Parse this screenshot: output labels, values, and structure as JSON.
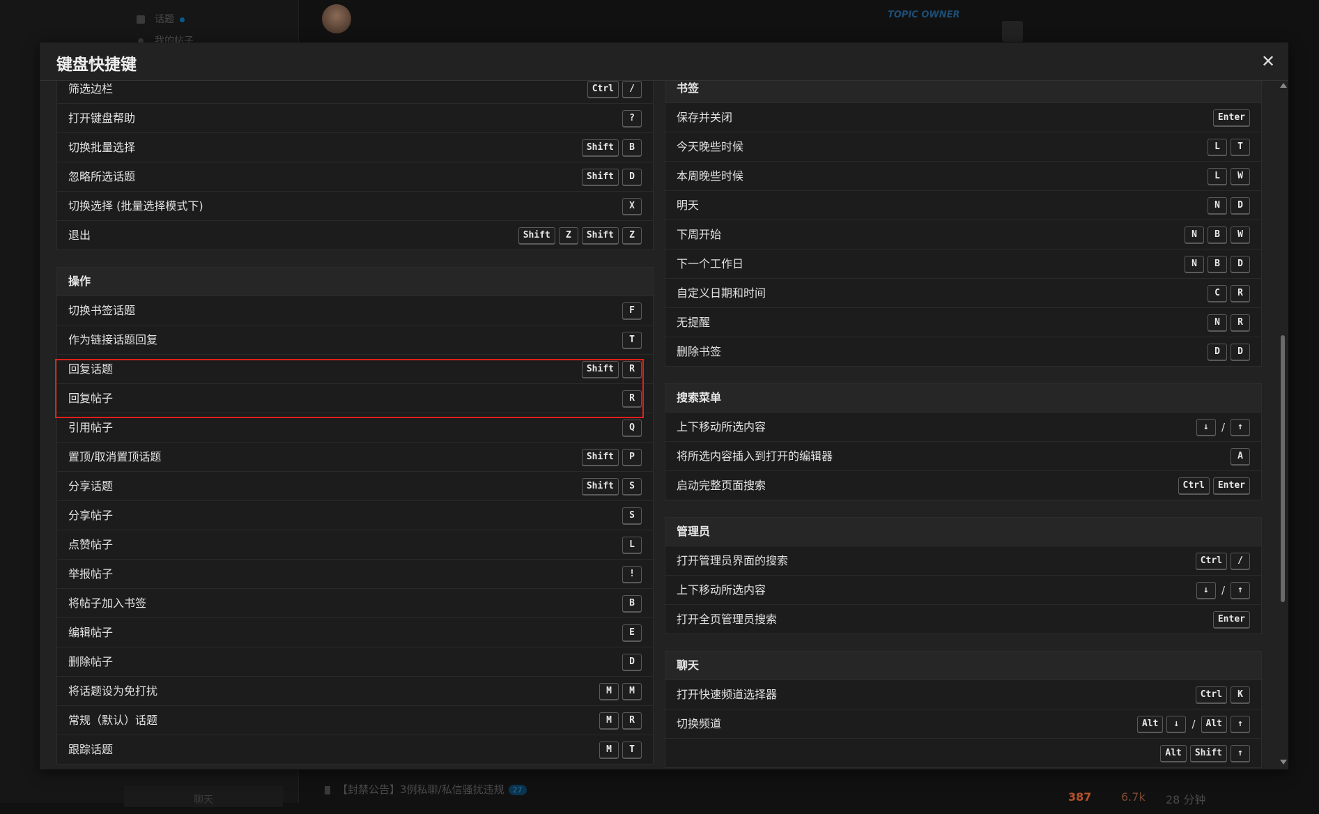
{
  "background": {
    "sidebar_items": [
      "话题",
      "我的帖子"
    ],
    "topic_owner": "TOPIC OWNER",
    "bottom_sidebar_item": "聊天",
    "announcement": "【封禁公告】3例私聊/私信骚扰违规",
    "announcement_badge": "27",
    "stats": [
      "387",
      "6.7k",
      "28 分钟"
    ]
  },
  "modal": {
    "title": "键盘快捷键",
    "close_symbol": "✕"
  },
  "left_top_rows": [
    {
      "label": "筛选边栏",
      "keys": [
        "Ctrl",
        "/"
      ]
    },
    {
      "label": "打开键盘帮助",
      "keys": [
        "?"
      ]
    },
    {
      "label": "切换批量选择",
      "keys": [
        "Shift",
        "B"
      ]
    },
    {
      "label": "忽略所选话题",
      "keys": [
        "Shift",
        "D"
      ]
    },
    {
      "label": "切换选择 (批量选择模式下)",
      "keys": [
        "X"
      ]
    },
    {
      "label": "退出",
      "keys": [
        "Shift",
        "Z",
        "Shift",
        "Z"
      ]
    }
  ],
  "actions": {
    "title": "操作",
    "rows": [
      {
        "label": "切换书签话题",
        "keys": [
          "F"
        ]
      },
      {
        "label": "作为链接话题回复",
        "keys": [
          "T"
        ]
      },
      {
        "label": "回复话题",
        "keys": [
          "Shift",
          "R"
        ]
      },
      {
        "label": "回复帖子",
        "keys": [
          "R"
        ]
      },
      {
        "label": "引用帖子",
        "keys": [
          "Q"
        ]
      },
      {
        "label": "置顶/取消置顶话题",
        "keys": [
          "Shift",
          "P"
        ]
      },
      {
        "label": "分享话题",
        "keys": [
          "Shift",
          "S"
        ]
      },
      {
        "label": "分享帖子",
        "keys": [
          "S"
        ]
      },
      {
        "label": "点赞帖子",
        "keys": [
          "L"
        ]
      },
      {
        "label": "举报帖子",
        "keys": [
          "!"
        ]
      },
      {
        "label": "将帖子加入书签",
        "keys": [
          "B"
        ]
      },
      {
        "label": "编辑帖子",
        "keys": [
          "E"
        ]
      },
      {
        "label": "删除帖子",
        "keys": [
          "D"
        ]
      },
      {
        "label": "将话题设为免打扰",
        "keys": [
          "M",
          "M"
        ]
      },
      {
        "label": "常规（默认）话题",
        "keys": [
          "M",
          "R"
        ]
      },
      {
        "label": "跟踪话题",
        "keys": [
          "M",
          "T"
        ]
      }
    ]
  },
  "bookmarks": {
    "title": "书签",
    "rows": [
      {
        "label": "保存并关闭",
        "keys": [
          "Enter"
        ]
      },
      {
        "label": "今天晚些时候",
        "keys": [
          "L",
          "T"
        ]
      },
      {
        "label": "本周晚些时候",
        "keys": [
          "L",
          "W"
        ]
      },
      {
        "label": "明天",
        "keys": [
          "N",
          "D"
        ]
      },
      {
        "label": "下周开始",
        "keys": [
          "N",
          "B",
          "W"
        ]
      },
      {
        "label": "下一个工作日",
        "keys": [
          "N",
          "B",
          "D"
        ]
      },
      {
        "label": "自定义日期和时间",
        "keys": [
          "C",
          "R"
        ]
      },
      {
        "label": "无提醒",
        "keys": [
          "N",
          "R"
        ]
      },
      {
        "label": "删除书签",
        "keys": [
          "D",
          "D"
        ]
      }
    ]
  },
  "search_menu": {
    "title": "搜索菜单",
    "rows": [
      {
        "label": "上下移动所选内容",
        "keys": [
          "↓",
          "/",
          "↑"
        ]
      },
      {
        "label": "将所选内容插入到打开的编辑器",
        "keys": [
          "A"
        ]
      },
      {
        "label": "启动完整页面搜索",
        "keys": [
          "Ctrl",
          "Enter"
        ]
      }
    ]
  },
  "admin": {
    "title": "管理员",
    "rows": [
      {
        "label": "打开管理员界面的搜索",
        "keys": [
          "Ctrl",
          "/"
        ]
      },
      {
        "label": "上下移动所选内容",
        "keys": [
          "↓",
          "/",
          "↑"
        ]
      },
      {
        "label": "打开全页管理员搜索",
        "keys": [
          "Enter"
        ]
      }
    ]
  },
  "chat": {
    "title": "聊天",
    "rows": [
      {
        "label": "打开快速频道选择器",
        "keys": [
          "Ctrl",
          "K"
        ]
      },
      {
        "label": "切换频道",
        "keys": [
          "Alt",
          "↓",
          "/",
          "Alt",
          "↑"
        ]
      },
      {
        "label": "",
        "keys": [
          "Alt",
          "Shift",
          "↑"
        ]
      }
    ]
  },
  "colors": {
    "highlight": "#e0201b",
    "modal_bg": "#222222",
    "stat_hot": "#b5522b",
    "stat_mid": "#7a4a35",
    "stat_muted": "#4a4a4a"
  }
}
